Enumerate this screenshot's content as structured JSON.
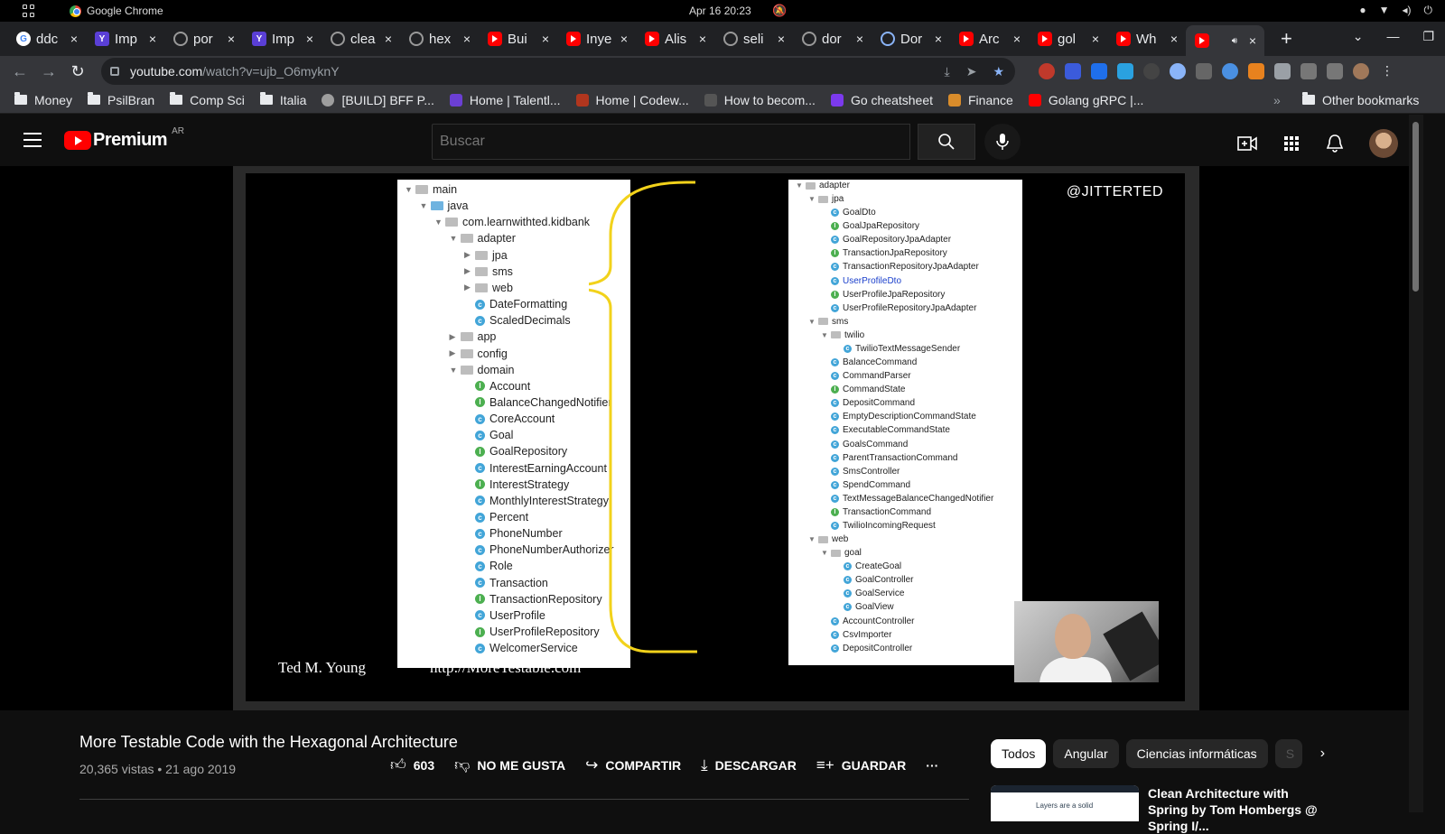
{
  "os": {
    "app_name": "Google Chrome",
    "clock": "Apr 16  20:23"
  },
  "tabs": [
    {
      "label": "ddc",
      "icon": "google-icon",
      "type": "g"
    },
    {
      "label": "Imp",
      "icon": "yahoo-icon",
      "type": "y"
    },
    {
      "label": "por",
      "icon": "github-icon",
      "type": "gh"
    },
    {
      "label": "Imp",
      "icon": "yahoo-icon",
      "type": "y"
    },
    {
      "label": "clea",
      "icon": "github-icon",
      "type": "gh"
    },
    {
      "label": "hex",
      "icon": "github-icon",
      "type": "gh"
    },
    {
      "label": "Bui",
      "icon": "youtube-icon",
      "type": "yt"
    },
    {
      "label": "Inye",
      "icon": "youtube-icon",
      "type": "yt"
    },
    {
      "label": "Alis",
      "icon": "youtube-icon",
      "type": "yt"
    },
    {
      "label": "seli",
      "icon": "github-icon",
      "type": "gh"
    },
    {
      "label": "dor",
      "icon": "github-icon",
      "type": "gh"
    },
    {
      "label": "Dor",
      "icon": "search-icon",
      "type": "q"
    },
    {
      "label": "Arc",
      "icon": "youtube-icon",
      "type": "yt"
    },
    {
      "label": "gol",
      "icon": "youtube-icon",
      "type": "yt"
    },
    {
      "label": "Wh",
      "icon": "youtube-icon",
      "type": "yt"
    },
    {
      "label": "",
      "icon": "youtube-icon",
      "type": "yt",
      "active": true
    }
  ],
  "address": {
    "domain": "youtube.com",
    "path": "/watch?v=ujb_O6myknY"
  },
  "bookmarks": [
    {
      "label": "Money",
      "icon": "folder-icon"
    },
    {
      "label": "PsilBran",
      "icon": "folder-icon"
    },
    {
      "label": "Comp Sci",
      "icon": "folder-icon"
    },
    {
      "label": "Italia",
      "icon": "folder-icon"
    },
    {
      "label": "[BUILD] BFF P...",
      "icon": "x-icon",
      "color": "#9e9e9e"
    },
    {
      "label": "Home | Talentl...",
      "icon": "talentlms-icon",
      "color": "#6b3fd4"
    },
    {
      "label": "Home | Codew...",
      "icon": "codewars-icon",
      "color": "#b1361e"
    },
    {
      "label": "How to becom...",
      "icon": "terminal-icon",
      "color": "#555555"
    },
    {
      "label": "Go cheatsheet",
      "icon": "bookmark-icon",
      "color": "#7c3aed"
    },
    {
      "label": "Finance",
      "icon": "chart-icon",
      "color": "#d98c2b"
    },
    {
      "label": "Golang gRPC |...",
      "icon": "youtube-icon",
      "color": "#ff0000"
    }
  ],
  "bookmarks_other": "Other bookmarks",
  "yt": {
    "logo_word": "Premium",
    "region": "AR",
    "search_placeholder": "Buscar"
  },
  "slide": {
    "handle": "@JITTERTED",
    "caption_left": "Ted M. Young",
    "caption_right": "http://MoreTestable.com",
    "left_tree": [
      {
        "t": "main",
        "k": "folder",
        "d": 0,
        "a": "▼"
      },
      {
        "t": "java",
        "k": "folder-blue",
        "d": 1,
        "a": "▼"
      },
      {
        "t": "com.learnwithted.kidbank",
        "k": "folder",
        "d": 2,
        "a": "▼"
      },
      {
        "t": "adapter",
        "k": "folder",
        "d": 3,
        "a": "▼"
      },
      {
        "t": "jpa",
        "k": "folder",
        "d": 4,
        "a": "▶"
      },
      {
        "t": "sms",
        "k": "folder",
        "d": 4,
        "a": "▶"
      },
      {
        "t": "web",
        "k": "folder",
        "d": 4,
        "a": "▶"
      },
      {
        "t": "DateFormatting",
        "k": "c",
        "d": 4
      },
      {
        "t": "ScaledDecimals",
        "k": "c",
        "d": 4
      },
      {
        "t": "app",
        "k": "folder",
        "d": 3,
        "a": "▶"
      },
      {
        "t": "config",
        "k": "folder",
        "d": 3,
        "a": "▶"
      },
      {
        "t": "domain",
        "k": "folder",
        "d": 3,
        "a": "▼"
      },
      {
        "t": "Account",
        "k": "i",
        "d": 4
      },
      {
        "t": "BalanceChangedNotifier",
        "k": "i",
        "d": 4
      },
      {
        "t": "CoreAccount",
        "k": "c",
        "d": 4
      },
      {
        "t": "Goal",
        "k": "c",
        "d": 4
      },
      {
        "t": "GoalRepository",
        "k": "i",
        "d": 4
      },
      {
        "t": "InterestEarningAccount",
        "k": "c",
        "d": 4
      },
      {
        "t": "InterestStrategy",
        "k": "i",
        "d": 4
      },
      {
        "t": "MonthlyInterestStrategy",
        "k": "c",
        "d": 4
      },
      {
        "t": "Percent",
        "k": "c",
        "d": 4
      },
      {
        "t": "PhoneNumber",
        "k": "c",
        "d": 4
      },
      {
        "t": "PhoneNumberAuthorizer",
        "k": "c",
        "d": 4
      },
      {
        "t": "Role",
        "k": "c",
        "d": 4
      },
      {
        "t": "Transaction",
        "k": "c",
        "d": 4
      },
      {
        "t": "TransactionRepository",
        "k": "i",
        "d": 4
      },
      {
        "t": "UserProfile",
        "k": "c",
        "d": 4
      },
      {
        "t": "UserProfileRepository",
        "k": "i",
        "d": 4
      },
      {
        "t": "WelcomerService",
        "k": "c",
        "d": 4
      }
    ],
    "right_tree": [
      {
        "t": "adapter",
        "k": "folder",
        "d": 0,
        "a": "▼"
      },
      {
        "t": "jpa",
        "k": "folder",
        "d": 1,
        "a": "▼"
      },
      {
        "t": "GoalDto",
        "k": "c",
        "d": 2
      },
      {
        "t": "GoalJpaRepository",
        "k": "i",
        "d": 2
      },
      {
        "t": "GoalRepositoryJpaAdapter",
        "k": "c",
        "d": 2
      },
      {
        "t": "TransactionJpaRepository",
        "k": "i",
        "d": 2
      },
      {
        "t": "TransactionRepositoryJpaAdapter",
        "k": "c",
        "d": 2
      },
      {
        "t": "UserProfileDto",
        "k": "c",
        "d": 2,
        "hl": true
      },
      {
        "t": "UserProfileJpaRepository",
        "k": "i",
        "d": 2
      },
      {
        "t": "UserProfileRepositoryJpaAdapter",
        "k": "c",
        "d": 2
      },
      {
        "t": "sms",
        "k": "folder",
        "d": 1,
        "a": "▼"
      },
      {
        "t": "twilio",
        "k": "folder",
        "d": 2,
        "a": "▼"
      },
      {
        "t": "TwilioTextMessageSender",
        "k": "c",
        "d": 3
      },
      {
        "t": "BalanceCommand",
        "k": "c",
        "d": 2
      },
      {
        "t": "CommandParser",
        "k": "c",
        "d": 2
      },
      {
        "t": "CommandState",
        "k": "i",
        "d": 2
      },
      {
        "t": "DepositCommand",
        "k": "c",
        "d": 2
      },
      {
        "t": "EmptyDescriptionCommandState",
        "k": "c",
        "d": 2
      },
      {
        "t": "ExecutableCommandState",
        "k": "c",
        "d": 2
      },
      {
        "t": "GoalsCommand",
        "k": "c",
        "d": 2
      },
      {
        "t": "ParentTransactionCommand",
        "k": "c",
        "d": 2
      },
      {
        "t": "SmsController",
        "k": "c",
        "d": 2
      },
      {
        "t": "SpendCommand",
        "k": "c",
        "d": 2
      },
      {
        "t": "TextMessageBalanceChangedNotifier",
        "k": "c",
        "d": 2
      },
      {
        "t": "TransactionCommand",
        "k": "i",
        "d": 2
      },
      {
        "t": "TwilioIncomingRequest",
        "k": "c",
        "d": 2
      },
      {
        "t": "web",
        "k": "folder",
        "d": 1,
        "a": "▼"
      },
      {
        "t": "goal",
        "k": "folder",
        "d": 2,
        "a": "▼"
      },
      {
        "t": "CreateGoal",
        "k": "c",
        "d": 3
      },
      {
        "t": "GoalController",
        "k": "c",
        "d": 3
      },
      {
        "t": "GoalService",
        "k": "c",
        "d": 3
      },
      {
        "t": "GoalView",
        "k": "c",
        "d": 3
      },
      {
        "t": "AccountController",
        "k": "c",
        "d": 2
      },
      {
        "t": "CsvImporter",
        "k": "c",
        "d": 2
      },
      {
        "t": "DepositController",
        "k": "c",
        "d": 2
      }
    ]
  },
  "video": {
    "title": "More Testable Code with the Hexagonal Architecture",
    "meta": "20,365 vistas • 21 ago 2019",
    "likes": "603",
    "dislike": "NO ME GUSTA",
    "share": "COMPARTIR",
    "download": "DESCARGAR",
    "save": "GUARDAR",
    "more": "···"
  },
  "chips": [
    "Todos",
    "Angular",
    "Ciencias informáticas",
    "S"
  ],
  "recommend": {
    "title": "Clean Architecture with Spring by Tom Hombergs @ Spring I/...",
    "thumb_text": "Layers are a solid"
  }
}
